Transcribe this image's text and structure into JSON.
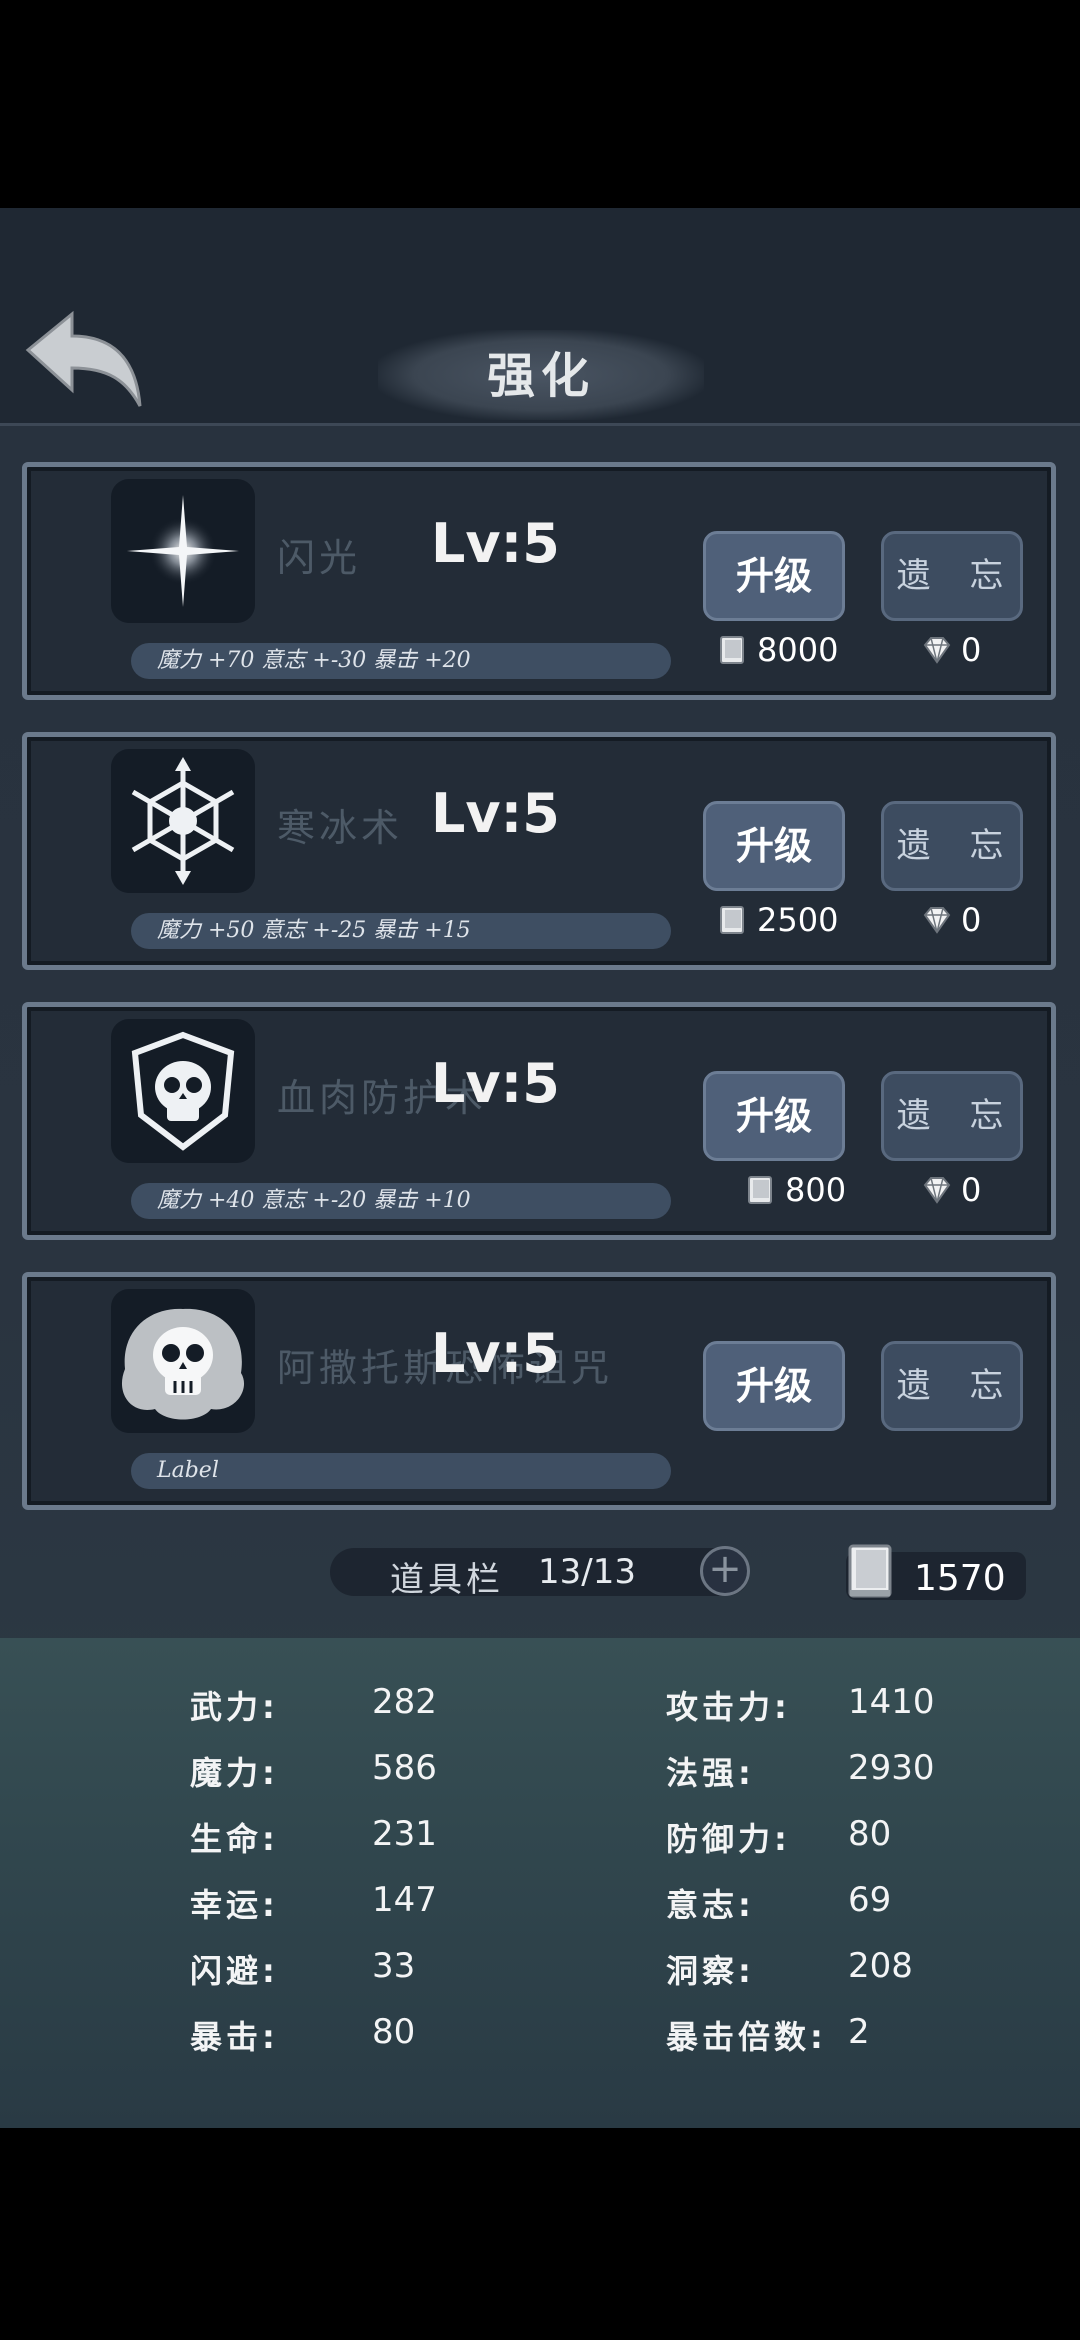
{
  "header": {
    "title": "强化"
  },
  "skills": [
    {
      "name": "闪光",
      "level": "Lv:5",
      "stats": "魔力 +70 意志 +-30 暴击 +20",
      "upgrade_label": "升级",
      "forget_label": "遗 忘",
      "book_cost": "8000",
      "gem_cost": "0",
      "icon": "sparkle-icon"
    },
    {
      "name": "寒冰术",
      "level": "Lv:5",
      "stats": "魔力 +50 意志 +-25 暴击 +15",
      "upgrade_label": "升级",
      "forget_label": "遗 忘",
      "book_cost": "2500",
      "gem_cost": "0",
      "icon": "snowflake-icon"
    },
    {
      "name": "血肉防护术",
      "level": "Lv:5",
      "stats": "魔力 +40 意志 +-20 暴击 +10",
      "upgrade_label": "升级",
      "forget_label": "遗 忘",
      "book_cost": "800",
      "gem_cost": "0",
      "icon": "skull-shield-icon"
    },
    {
      "name": "阿撒托斯恐怖诅咒",
      "level": "Lv:5",
      "stats": "Label",
      "upgrade_label": "升级",
      "forget_label": "遗 忘",
      "icon": "skull-icon"
    }
  ],
  "itembar": {
    "label": "道具栏",
    "count": "13/13",
    "add_label": "+"
  },
  "book_total": "1570",
  "attributes": {
    "left": [
      {
        "label": "武力:",
        "value": "282"
      },
      {
        "label": "魔力:",
        "value": "586"
      },
      {
        "label": "生命:",
        "value": "231"
      },
      {
        "label": "幸运:",
        "value": "147"
      },
      {
        "label": "闪避:",
        "value": "33"
      },
      {
        "label": "暴击:",
        "value": "80"
      }
    ],
    "right": [
      {
        "label": "攻击力:",
        "value": "1410"
      },
      {
        "label": "法强:",
        "value": "2930"
      },
      {
        "label": "防御力:",
        "value": "80"
      },
      {
        "label": "意志:",
        "value": "69"
      },
      {
        "label": "洞察:",
        "value": "208"
      },
      {
        "label": "暴击倍数:",
        "value": "2"
      }
    ]
  },
  "colors": {
    "background": "#27313d",
    "button": "#4f6079",
    "panel": "#31474e"
  }
}
